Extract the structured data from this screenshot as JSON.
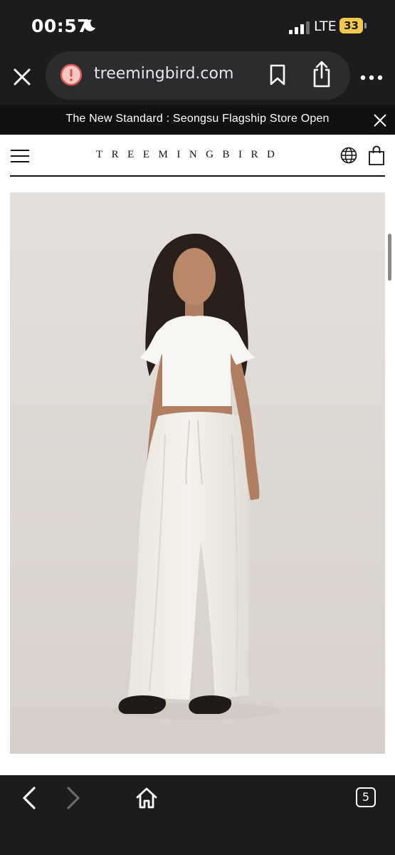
{
  "status_bar": {
    "time": "00:57",
    "network": "LTE",
    "battery": "33"
  },
  "browser": {
    "url": "treemingbird.com",
    "tab_count": "5"
  },
  "announcement": {
    "text": "The New Standard : Seongsu Flagship Store Open"
  },
  "site": {
    "logo": "TREEMINGBIRD"
  },
  "icons": {
    "status": [
      "moon-icon",
      "signal-icon",
      "battery-icon"
    ],
    "browser": [
      "close-icon",
      "warning-icon",
      "bookmark-icon",
      "share-icon",
      "more-icon"
    ],
    "site": [
      "menu-icon",
      "globe-icon",
      "shopping-bag-icon"
    ],
    "toolbar": [
      "back-icon",
      "forward-icon",
      "home-icon",
      "tabs-icon"
    ]
  },
  "colors": {
    "browser_chrome": "#1c1c1e",
    "url_pill": "#2c2c2e",
    "announcement_bar": "#111111",
    "warning": "#d9534f",
    "battery": "#f2c94c",
    "photo_background": "#e0dad5"
  }
}
